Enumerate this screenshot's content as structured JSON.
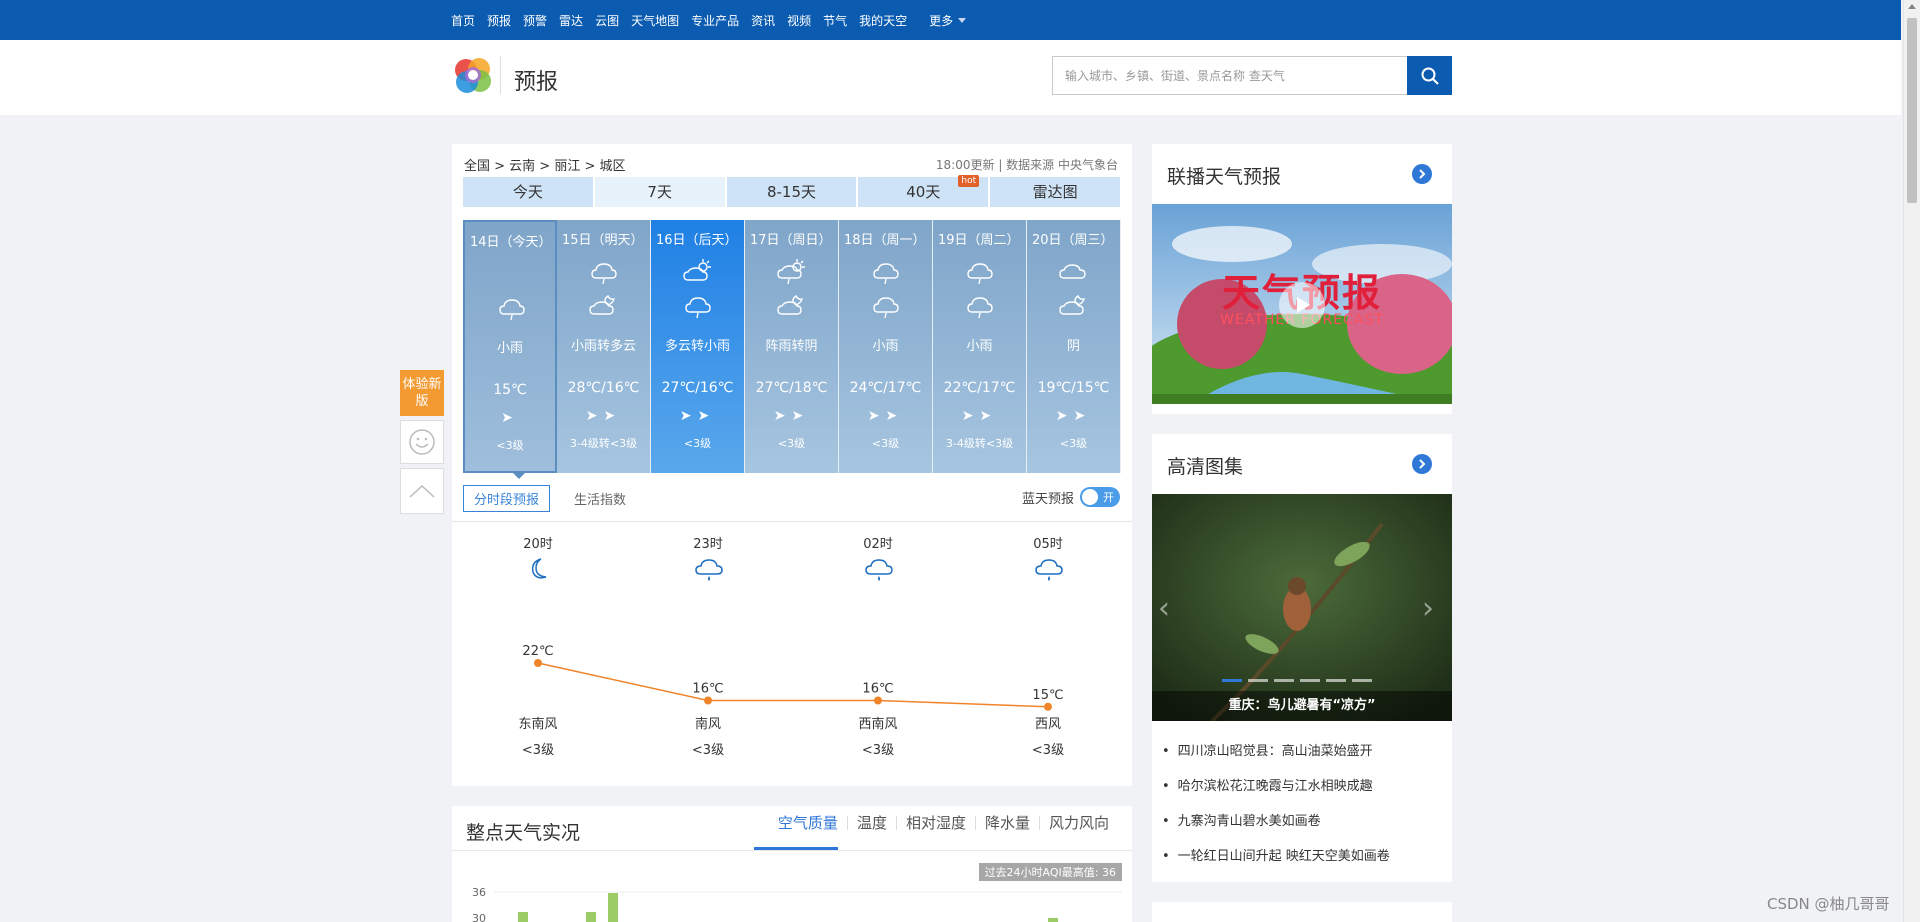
{
  "topnav": {
    "items": [
      "首页",
      "预报",
      "预警",
      "雷达",
      "云图",
      "天气地图",
      "专业产品",
      "资讯",
      "视频",
      "节气",
      "我的天空"
    ],
    "more": "更多"
  },
  "header": {
    "title": "预报",
    "search_placeholder": "输入城市、乡镇、街道、景点名称 查天气"
  },
  "forecast": {
    "breadcrumb": "全国 > 云南 > 丽江 > 城区",
    "update": "18:00更新",
    "source": "数据来源 中央气象台",
    "tabs": [
      "今天",
      "7天",
      "8-15天",
      "40天",
      "雷达图"
    ],
    "hot_badge": "hot",
    "days": [
      {
        "date": "14日（今天）",
        "desc": "小雨",
        "temp": "15℃",
        "level": "<3级",
        "icon1": "",
        "icon2": "rain-icon",
        "wind1": "wind-arrow-icon"
      },
      {
        "date": "15日（明天）",
        "desc": "小雨转多云",
        "temp": "28℃/16℃",
        "level": "3-4级转<3级",
        "icon1": "rain-icon",
        "icon2": "cloud-moon-icon"
      },
      {
        "date": "16日（后天）",
        "desc": "多云转小雨",
        "temp": "27℃/16℃",
        "level": "<3级",
        "icon1": "sun-cloud-icon",
        "icon2": "rain-icon"
      },
      {
        "date": "17日（周日）",
        "desc": "阵雨转阴",
        "temp": "27℃/18℃",
        "level": "<3级",
        "icon1": "sun-rain-icon",
        "icon2": "cloud-moon-icon"
      },
      {
        "date": "18日（周一）",
        "desc": "小雨",
        "temp": "24℃/17℃",
        "level": "<3级",
        "icon1": "rain-icon",
        "icon2": "rain-icon"
      },
      {
        "date": "19日（周二）",
        "desc": "小雨",
        "temp": "22℃/17℃",
        "level": "3-4级转<3级",
        "icon1": "rain-icon",
        "icon2": "rain-icon"
      },
      {
        "date": "20日（周三）",
        "desc": "阴",
        "temp": "19℃/15℃",
        "level": "<3级",
        "icon1": "cloud-icon",
        "icon2": "cloud-moon-icon"
      }
    ],
    "subtabs": [
      "分时段预报",
      "生活指数"
    ],
    "bluesky_label": "蓝天预报",
    "toggle_text": "开"
  },
  "hourly": [
    {
      "time": "20时",
      "icon": "moon-icon",
      "temp": 22,
      "temp_label": "22℃",
      "wind": "东南风",
      "level": "<3级"
    },
    {
      "time": "23时",
      "icon": "rain-icon",
      "temp": 16,
      "temp_label": "16℃",
      "wind": "南风",
      "level": "<3级"
    },
    {
      "time": "02时",
      "icon": "rain-icon",
      "temp": 16,
      "temp_label": "16℃",
      "wind": "西南风",
      "level": "<3级"
    },
    {
      "time": "05时",
      "icon": "rain-icon",
      "temp": 15,
      "temp_label": "15℃",
      "wind": "西风",
      "level": "<3级"
    }
  ],
  "observation": {
    "title": "整点天气实况",
    "tabs": [
      "空气质量",
      "温度",
      "相对湿度",
      "降水量",
      "风力风向"
    ],
    "aqi_badge": "过去24小时AQI最高值: 36",
    "y_tick": "36",
    "y_tick2": "30"
  },
  "side": {
    "broadcast_title": "联播天气预报",
    "video_text": "天气预报",
    "video_sub": "WEATHER FORECAST",
    "gallery_title": "高清图集",
    "gallery_caption": "重庆：鸟儿避暑有“凉方”",
    "news": [
      "四川凉山昭觉县：高山油菜始盛开",
      "哈尔滨松花江晚霞与江水相映成趣",
      "九寨沟青山碧水美如画卷",
      "一轮红日山间升起 映红天空美如画卷"
    ]
  },
  "float": {
    "new_version": "体验新版"
  },
  "watermark": "CSDN @柚几哥哥"
}
